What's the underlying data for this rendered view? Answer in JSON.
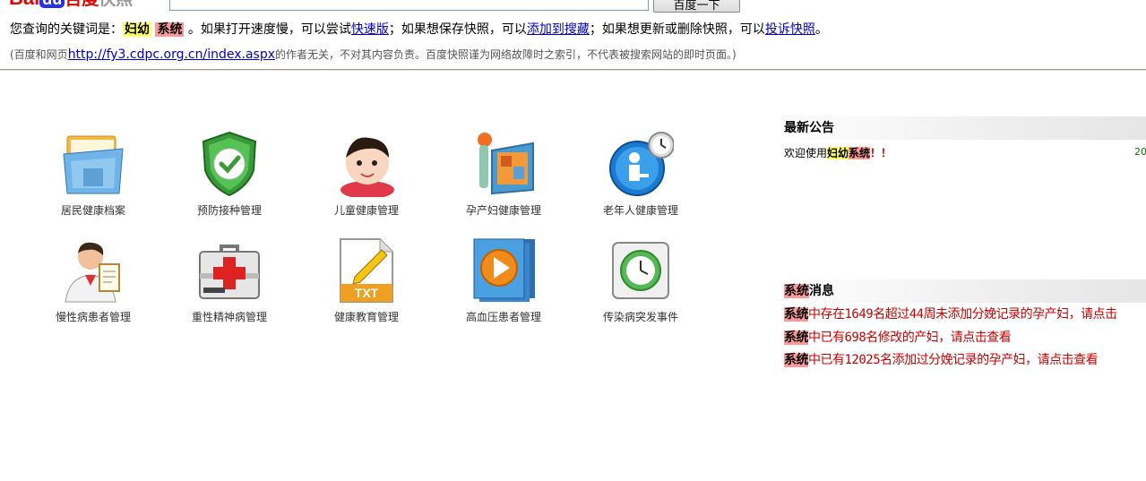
{
  "snapshot": {
    "logo_bai": "Bai",
    "logo_du": "du",
    "logo_cn1": "百度",
    "logo_cn2": "快照",
    "search_button": "百度一下",
    "kw_prefix": "您查询的关键词是：",
    "kw1": "妇幼",
    "kw2": "系统",
    "kw_text1": "。如果打开速度慢，可以尝试",
    "kw_link1": "快速版",
    "kw_text2": "；如果想保存快照，可以",
    "kw_link2": "添加到搜藏",
    "kw_text3": "；如果想更新或删除快照，可以",
    "kw_link3": "投诉快照",
    "kw_text4": "。",
    "disc_prefix": "(百度和网页",
    "disc_url": "http://fy3.cdpc.org.cn/index.aspx",
    "disc_text": "的作者无关，不对其内容负责。百度快照谨为网络故障时之索引，不代表被搜索网站的即时页面。)"
  },
  "tiles": [
    {
      "label": "居民健康档案",
      "icon": "folder-icon"
    },
    {
      "label": "预防接种管理",
      "icon": "shield-check-icon"
    },
    {
      "label": "儿童健康管理",
      "icon": "baby-icon"
    },
    {
      "label": "孕产妇健康管理",
      "icon": "photo-frame-icon"
    },
    {
      "label": "老年人健康管理",
      "icon": "clock-person-icon"
    },
    {
      "label": "慢性病患者管理",
      "icon": "doctor-icon"
    },
    {
      "label": "重性精神病管理",
      "icon": "first-aid-kit-icon"
    },
    {
      "label": "健康教育管理",
      "icon": "txt-file-icon"
    },
    {
      "label": "高血压患者管理",
      "icon": "media-player-icon"
    },
    {
      "label": "传染病突发事件",
      "icon": "clock-icon"
    }
  ],
  "announcements": {
    "title": "最新公告",
    "item_prefix": "欢迎使用",
    "item_kw1": "妇幼",
    "item_kw2": "系统",
    "item_suffix": "！！",
    "item_date": "20"
  },
  "messages": {
    "title_kw": "系统",
    "title_rest": "消息",
    "items": [
      {
        "kw": "系统",
        "text": "中存在1649名超过44周未添加分娩记录的孕产妇，请点击"
      },
      {
        "kw": "系统",
        "text": "中已有698名修改的产妇，请点击查看"
      },
      {
        "kw": "系统",
        "text": "中已有12025名添加过分娩记录的孕产妇，请点击查看"
      }
    ]
  }
}
